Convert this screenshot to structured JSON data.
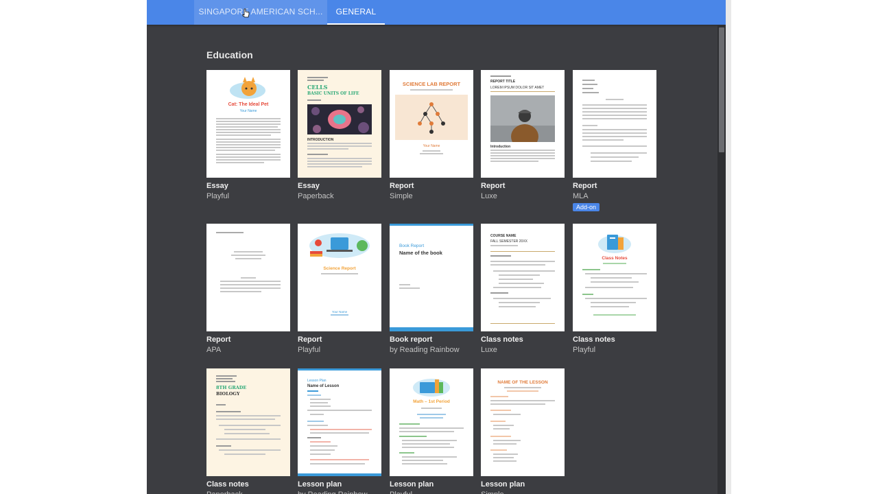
{
  "tabs": [
    {
      "label": "SINGAPORE AMERICAN SCH..."
    },
    {
      "label": "GENERAL"
    }
  ],
  "section": {
    "title": "Education"
  },
  "templates": [
    {
      "name": "Essay",
      "style": "Playful",
      "title": "Cat: The Ideal Pet",
      "subtitle": "Your Name"
    },
    {
      "name": "Essay",
      "style": "Paperback",
      "title": "CELLS",
      "subtitle": "BASIC UNITS OF LIFE",
      "heading": "INTRODUCTION"
    },
    {
      "name": "Report",
      "style": "Simple",
      "title": "SCIENCE LAB REPORT",
      "subtitle": "Your Name"
    },
    {
      "name": "Report",
      "style": "Luxe",
      "title": "REPORT TITLE",
      "subtitle": "LOREM IPSUM DOLOR SIT AMET",
      "heading": "Introduction"
    },
    {
      "name": "Report",
      "style": "MLA",
      "badge": "Add-on"
    },
    {
      "name": "Report",
      "style": "APA"
    },
    {
      "name": "Report",
      "style": "Playful",
      "title": "Science Report",
      "subtitle": "Your Name"
    },
    {
      "name": "Book report",
      "style": "by Reading Rainbow",
      "title": "Book Report",
      "subtitle": "Name of the book"
    },
    {
      "name": "Class notes",
      "style": "Luxe",
      "title": "COURSE NAME",
      "subtitle": "FALL SEMESTER 20XX"
    },
    {
      "name": "Class notes",
      "style": "Playful",
      "title": "Class Notes"
    },
    {
      "name": "Class notes",
      "style": "Paperback",
      "title": "8TH GRADE",
      "subtitle": "BIOLOGY"
    },
    {
      "name": "Lesson plan",
      "style": "by Reading Rainbow",
      "title": "Lesson Plan",
      "subtitle": "Name of Lesson"
    },
    {
      "name": "Lesson plan",
      "style": "Playful",
      "title": "Math – 1st Period"
    },
    {
      "name": "Lesson plan",
      "style": "Simple",
      "title": "NAME OF THE LESSON"
    }
  ],
  "icons": [
    "cursor-icon"
  ],
  "colors": {
    "topbar": "#4a86e8",
    "background": "#3c3d41",
    "badge": "#4a86e8"
  }
}
